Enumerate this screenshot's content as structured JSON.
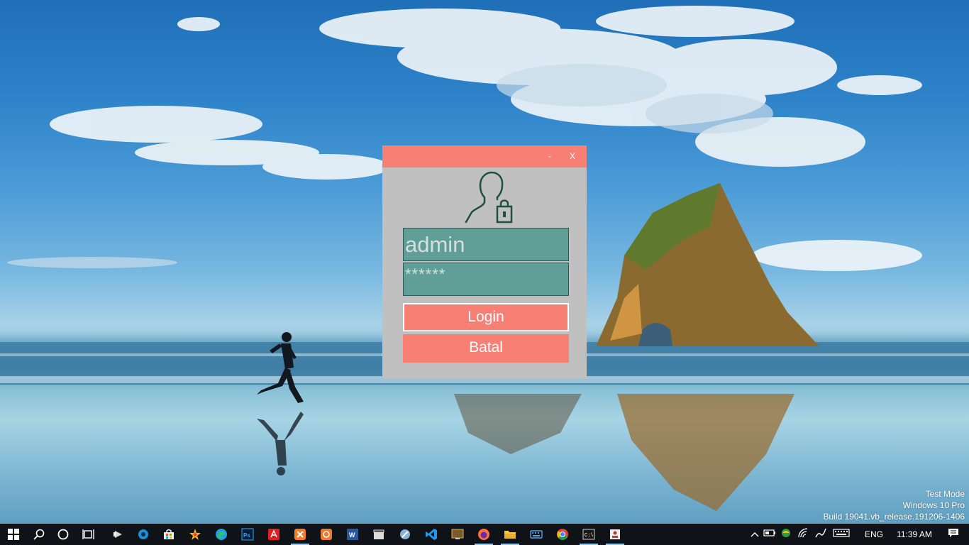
{
  "dialog": {
    "minimize_label": "-",
    "close_label": "X",
    "username_value": "admin",
    "password_mask": "******",
    "login_label": "Login",
    "cancel_label": "Batal",
    "colors": {
      "titlebar": "#f77f74",
      "background": "#c0c0c0",
      "field": "#5f9f97",
      "button": "#f77f74",
      "icon": "#1f4f3f"
    },
    "icon": "user-lock-icon"
  },
  "watermark": {
    "line1": "Test Mode",
    "line2": "Windows 10 Pro",
    "line3": "Build 19041.vb_release.191206-1406"
  },
  "taskbar": {
    "pinned": [
      {
        "name": "start-icon"
      },
      {
        "name": "search-icon"
      },
      {
        "name": "cortana-icon"
      },
      {
        "name": "task-view-icon"
      },
      {
        "name": "winamp-icon"
      },
      {
        "name": "media-icon"
      },
      {
        "name": "store-icon"
      },
      {
        "name": "star-app-icon"
      },
      {
        "name": "edge-icon"
      },
      {
        "name": "photoshop-icon"
      },
      {
        "name": "acrobat-icon"
      },
      {
        "name": "xampp-icon"
      },
      {
        "name": "app-orange-icon"
      },
      {
        "name": "word-icon"
      },
      {
        "name": "clapper-icon"
      },
      {
        "name": "tool-icon"
      },
      {
        "name": "vscode-icon"
      },
      {
        "name": "monitor-app-icon"
      },
      {
        "name": "firefox-icon"
      },
      {
        "name": "file-explorer-icon"
      },
      {
        "name": "keyboard-app-icon"
      },
      {
        "name": "chrome-icon"
      },
      {
        "name": "terminal-icon"
      },
      {
        "name": "login-app-icon"
      }
    ],
    "tray": {
      "language": "ENG",
      "time": "11:39 AM"
    }
  }
}
